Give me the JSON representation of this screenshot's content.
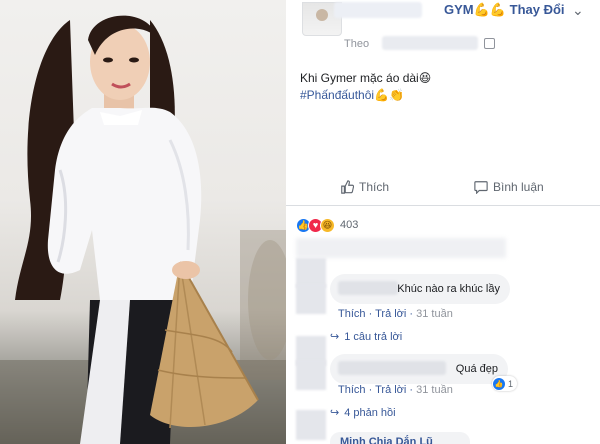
{
  "post": {
    "poster_name": "GYM",
    "poster_emoji": "💪💪",
    "poster_action": "Thay Đổi",
    "via_label": "Theo",
    "text": "Khi Gymer mặc áo dài😆",
    "hashtag": "#Phấnđấuthôi💪👏"
  },
  "actions": {
    "like_label": "Thích",
    "comment_label": "Bình luận"
  },
  "reactions": {
    "icons": [
      "like-icon",
      "love-icon",
      "haha-icon"
    ],
    "count": "403"
  },
  "comments": [
    {
      "text": "Khúc nào ra khúc lầy",
      "like_label": "Thích",
      "reply_label": "Trả lời",
      "time": "31 tuần",
      "replies_label": "1 câu trả lời"
    },
    {
      "text": "Quá đẹp",
      "like_label": "Thích",
      "reply_label": "Trả lời",
      "time": "31 tuần",
      "like_count": "1",
      "replies_label": "4 phản hồi"
    }
  ],
  "last_comment": {
    "name": "Minh Chia Dắn Lũ"
  },
  "colors": {
    "link": "#385898",
    "facebook_blue": "#1877f2",
    "meta_gray": "#90949c",
    "bubble_bg": "#f2f3f5"
  }
}
